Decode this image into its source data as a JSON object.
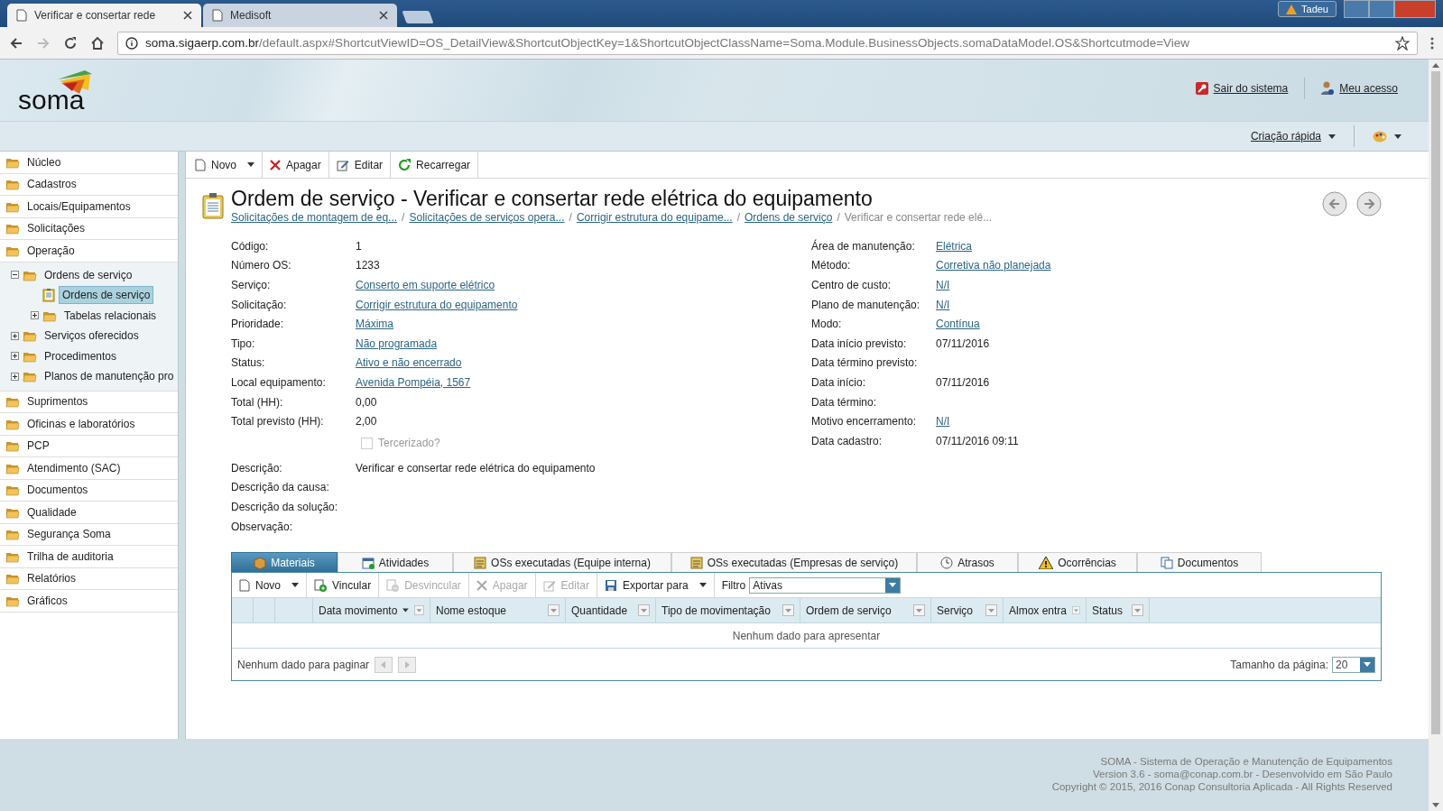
{
  "browser": {
    "tabs": [
      {
        "title": "Verificar e consertar rede",
        "selected": true
      },
      {
        "title": "Medisoft",
        "selected": false
      }
    ],
    "user_badge": "Tadeu",
    "url": {
      "host": "soma.sigaerp.com.br",
      "path": "/default.aspx#ShortcutViewID=OS_DetailView&ShortcutObjectKey=1&ShortcutObjectClassName=Soma.Module.BusinessObjects.somaDataModel.OS&Shortcutmode=View"
    }
  },
  "header": {
    "logo": "soma",
    "links": [
      "Sair do sistema",
      "Meu acesso"
    ],
    "quick_create": "Criação rápida"
  },
  "sidebar": {
    "items": [
      {
        "label": "Núcleo",
        "kind": "folder",
        "selected": false
      },
      {
        "label": "Cadastros",
        "kind": "folder",
        "selected": false
      },
      {
        "label": "Locais/Equipamentos",
        "kind": "folder",
        "selected": false
      },
      {
        "label": "Solicitações",
        "kind": "folder",
        "selected": false
      },
      {
        "label": "Operação",
        "kind": "folder",
        "selected": false,
        "children": [
          {
            "label": "Ordens de serviço",
            "kind": "folder",
            "selected": false,
            "expanded": true,
            "children": [
              {
                "label": "Ordens de serviço",
                "kind": "document",
                "selected": true
              },
              {
                "label": "Tabelas relacionais",
                "kind": "folder",
                "selected": false,
                "expanded": false
              }
            ]
          },
          {
            "label": "Serviços oferecidos",
            "kind": "folder",
            "selected": false,
            "expanded": false
          },
          {
            "label": "Procedimentos",
            "kind": "folder",
            "selected": false,
            "expanded": false
          },
          {
            "label": "Planos de manutenção pro",
            "kind": "folder",
            "selected": false,
            "expanded": false
          }
        ]
      },
      {
        "label": "Suprimentos",
        "kind": "folder",
        "selected": false
      },
      {
        "label": "Oficinas e laboratórios",
        "kind": "folder",
        "selected": false
      },
      {
        "label": "PCP",
        "kind": "folder",
        "selected": false
      },
      {
        "label": "Atendimento (SAC)",
        "kind": "folder",
        "selected": false
      },
      {
        "label": "Documentos",
        "kind": "folder",
        "selected": false
      },
      {
        "label": "Qualidade",
        "kind": "folder",
        "selected": false
      },
      {
        "label": "Segurança Soma",
        "kind": "folder",
        "selected": false
      },
      {
        "label": "Trilha de auditoria",
        "kind": "folder",
        "selected": false
      },
      {
        "label": "Relatórios",
        "kind": "folder",
        "selected": false
      },
      {
        "label": "Gráficos",
        "kind": "folder",
        "selected": false
      }
    ]
  },
  "toolbar": [
    {
      "label": "Novo",
      "dropdown": true
    },
    {
      "label": "Apagar",
      "dropdown": false
    },
    {
      "label": "Editar",
      "dropdown": false
    },
    {
      "label": "Recarregar",
      "dropdown": false
    }
  ],
  "title": "Ordem de serviço - Verificar e consertar rede elétrica do equipamento",
  "breadcrumbs": [
    {
      "text": "Solicitações de montagem de eq...",
      "kind": "link"
    },
    {
      "text": "/",
      "kind": "separator"
    },
    {
      "text": "Solicitações de serviços opera...",
      "kind": "link"
    },
    {
      "text": "/",
      "kind": "separator"
    },
    {
      "text": "Corrigir estrutura do equipame...",
      "kind": "link"
    },
    {
      "text": "/",
      "kind": "separator"
    },
    {
      "text": "Ordens de serviço",
      "kind": "link"
    },
    {
      "text": "/",
      "kind": "separator"
    },
    {
      "text": "Verificar e consertar rede elé...",
      "kind": "current"
    }
  ],
  "fields_left": [
    {
      "label": "Código:",
      "value": "1",
      "link": false
    },
    {
      "label": "Número OS:",
      "value": "1233",
      "link": false
    },
    {
      "label": "Serviço:",
      "value": "Conserto em suporte elétrico",
      "link": true
    },
    {
      "label": "Solicitação:",
      "value": "Corrigir estrutura do equipamento",
      "link": true
    },
    {
      "label": "Prioridade:",
      "value": "Máxima",
      "link": true
    },
    {
      "label": "Tipo:",
      "value": "Não programada",
      "link": true
    },
    {
      "label": "Status:",
      "value": "Ativo e não encerrado",
      "link": true
    },
    {
      "label": "Local equipamento:",
      "value": "Avenida Pompéia, 1567",
      "link": true
    },
    {
      "label": "Total (HH):",
      "value": "0,00",
      "link": false
    },
    {
      "label": "Total previsto (HH):",
      "value": "2,00",
      "link": false
    }
  ],
  "outsourced": {
    "label": "Tercerizado?",
    "checked": false,
    "disabled": true
  },
  "fields_right": [
    {
      "label": "Área de manutenção:",
      "value": "Elétrica",
      "link": true
    },
    {
      "label": "Método:",
      "value": "Corretiva não planejada",
      "link": true
    },
    {
      "label": "Centro de custo:",
      "value": "N/I",
      "link": true
    },
    {
      "label": "Plano de manutenção:",
      "value": "N/I",
      "link": true
    },
    {
      "label": "Modo:",
      "value": "Contínua",
      "link": true
    },
    {
      "label": "Data início previsto:",
      "value": "07/11/2016",
      "link": false
    },
    {
      "label": "Data término previsto:"
    },
    {
      "label": "Data início:",
      "value": "07/11/2016",
      "link": false
    },
    {
      "label": "Data término:"
    },
    {
      "label": "Motivo encerramento:",
      "value": "N/I",
      "link": true
    },
    {
      "label": "Data cadastro:",
      "value": "07/11/2016 09:11",
      "link": false
    }
  ],
  "descriptions": [
    {
      "label": "Descrição:",
      "value": "Verificar e consertar rede elétrica do equipamento"
    },
    {
      "label": "Descrição da causa:"
    },
    {
      "label": "Descrição da solução:"
    },
    {
      "label": "Observação:"
    }
  ],
  "detail_tabs": [
    {
      "label": "Materiais",
      "selected": true
    },
    {
      "label": "Atividades",
      "selected": false
    },
    {
      "label": "OSs executadas (Equipe interna)",
      "selected": false
    },
    {
      "label": "OSs executadas (Empresas de serviço)",
      "selected": false
    },
    {
      "label": "Atrasos",
      "selected": false
    },
    {
      "label": "Ocorrências",
      "selected": false
    },
    {
      "label": "Documentos",
      "selected": false
    }
  ],
  "grid": {
    "toolbar": [
      {
        "label": "Novo",
        "disabled": false,
        "dropdown": true
      },
      {
        "label": "Vincular",
        "disabled": false,
        "dropdown": false
      },
      {
        "label": "Desvincular",
        "disabled": true,
        "dropdown": false
      },
      {
        "label": "Apagar",
        "disabled": true,
        "dropdown": false
      },
      {
        "label": "Editar",
        "disabled": true,
        "dropdown": false
      },
      {
        "label": "Exportar para",
        "disabled": false,
        "dropdown": true
      }
    ],
    "filter": {
      "label": "Filtro",
      "value": "Ativas"
    },
    "columns": [
      {
        "label": "Data movimento",
        "sorted": true
      },
      {
        "label": "Nome estoque",
        "sorted": false
      },
      {
        "label": "Quantidade",
        "sorted": false
      },
      {
        "label": "Tipo de movimentação",
        "sorted": false
      },
      {
        "label": "Ordem de serviço",
        "sorted": false
      },
      {
        "label": "Serviço",
        "sorted": false
      },
      {
        "label": "Almox entra",
        "sorted": false
      },
      {
        "label": "Status",
        "sorted": false
      }
    ],
    "empty_text": "Nenhum dado para apresentar",
    "pager_text": "Nenhum dado para paginar",
    "page_size_label": "Tamanho da página:",
    "page_size": "20"
  },
  "footer": [
    "SOMA - Sistema de Operação e Manutenção de Equipamentos",
    "Version 3.6 - soma@conap.com.br - Desenvolvido em São Paulo",
    "Copyright © 2015, 2016 Conap Consultoria Aplicada - All Rights Reserved"
  ]
}
